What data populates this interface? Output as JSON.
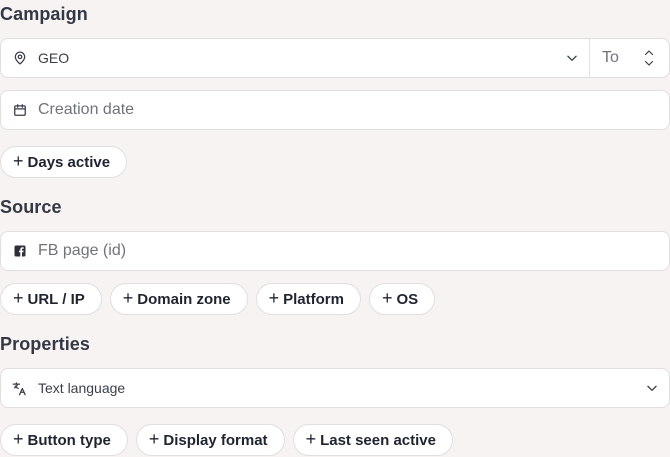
{
  "sections": {
    "campaign": {
      "title": "Campaign"
    },
    "source": {
      "title": "Source"
    },
    "properties": {
      "title": "Properties"
    }
  },
  "campaign": {
    "geo": {
      "label": "GEO",
      "icon": "map-pin-icon"
    },
    "to_label": "To",
    "creation_date": {
      "placeholder": "Creation date",
      "icon": "calendar-icon"
    },
    "chips": [
      {
        "label": "Days active"
      }
    ]
  },
  "source": {
    "fb_page": {
      "placeholder": "FB page (id)",
      "icon": "facebook-icon"
    },
    "chips": [
      {
        "label": "URL / IP"
      },
      {
        "label": "Domain zone"
      },
      {
        "label": "Platform"
      },
      {
        "label": "OS"
      }
    ]
  },
  "properties": {
    "text_language": {
      "label": "Text language",
      "icon": "translate-icon"
    },
    "chips": [
      {
        "label": "Button type"
      },
      {
        "label": "Display format"
      },
      {
        "label": "Last seen active"
      }
    ]
  }
}
